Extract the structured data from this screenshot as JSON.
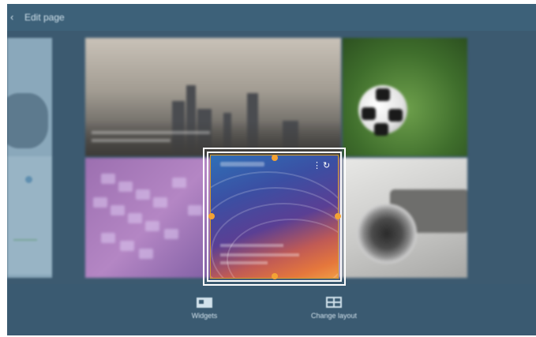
{
  "header": {
    "back_icon": "back-arrow-icon",
    "title": "Edit page"
  },
  "widget": {
    "menu_icon": "more-options-icon",
    "refresh_icon": "refresh-icon"
  },
  "bottom_bar": {
    "widgets_label": "Widgets",
    "widgets_icon": "widgets-icon",
    "change_layout_label": "Change layout",
    "change_layout_icon": "change-layout-icon"
  },
  "colors": {
    "background": "#3c5a70",
    "topbar": "#3d6179",
    "selection_frame": "#ffffff",
    "resize_handle": "#f3a234"
  }
}
